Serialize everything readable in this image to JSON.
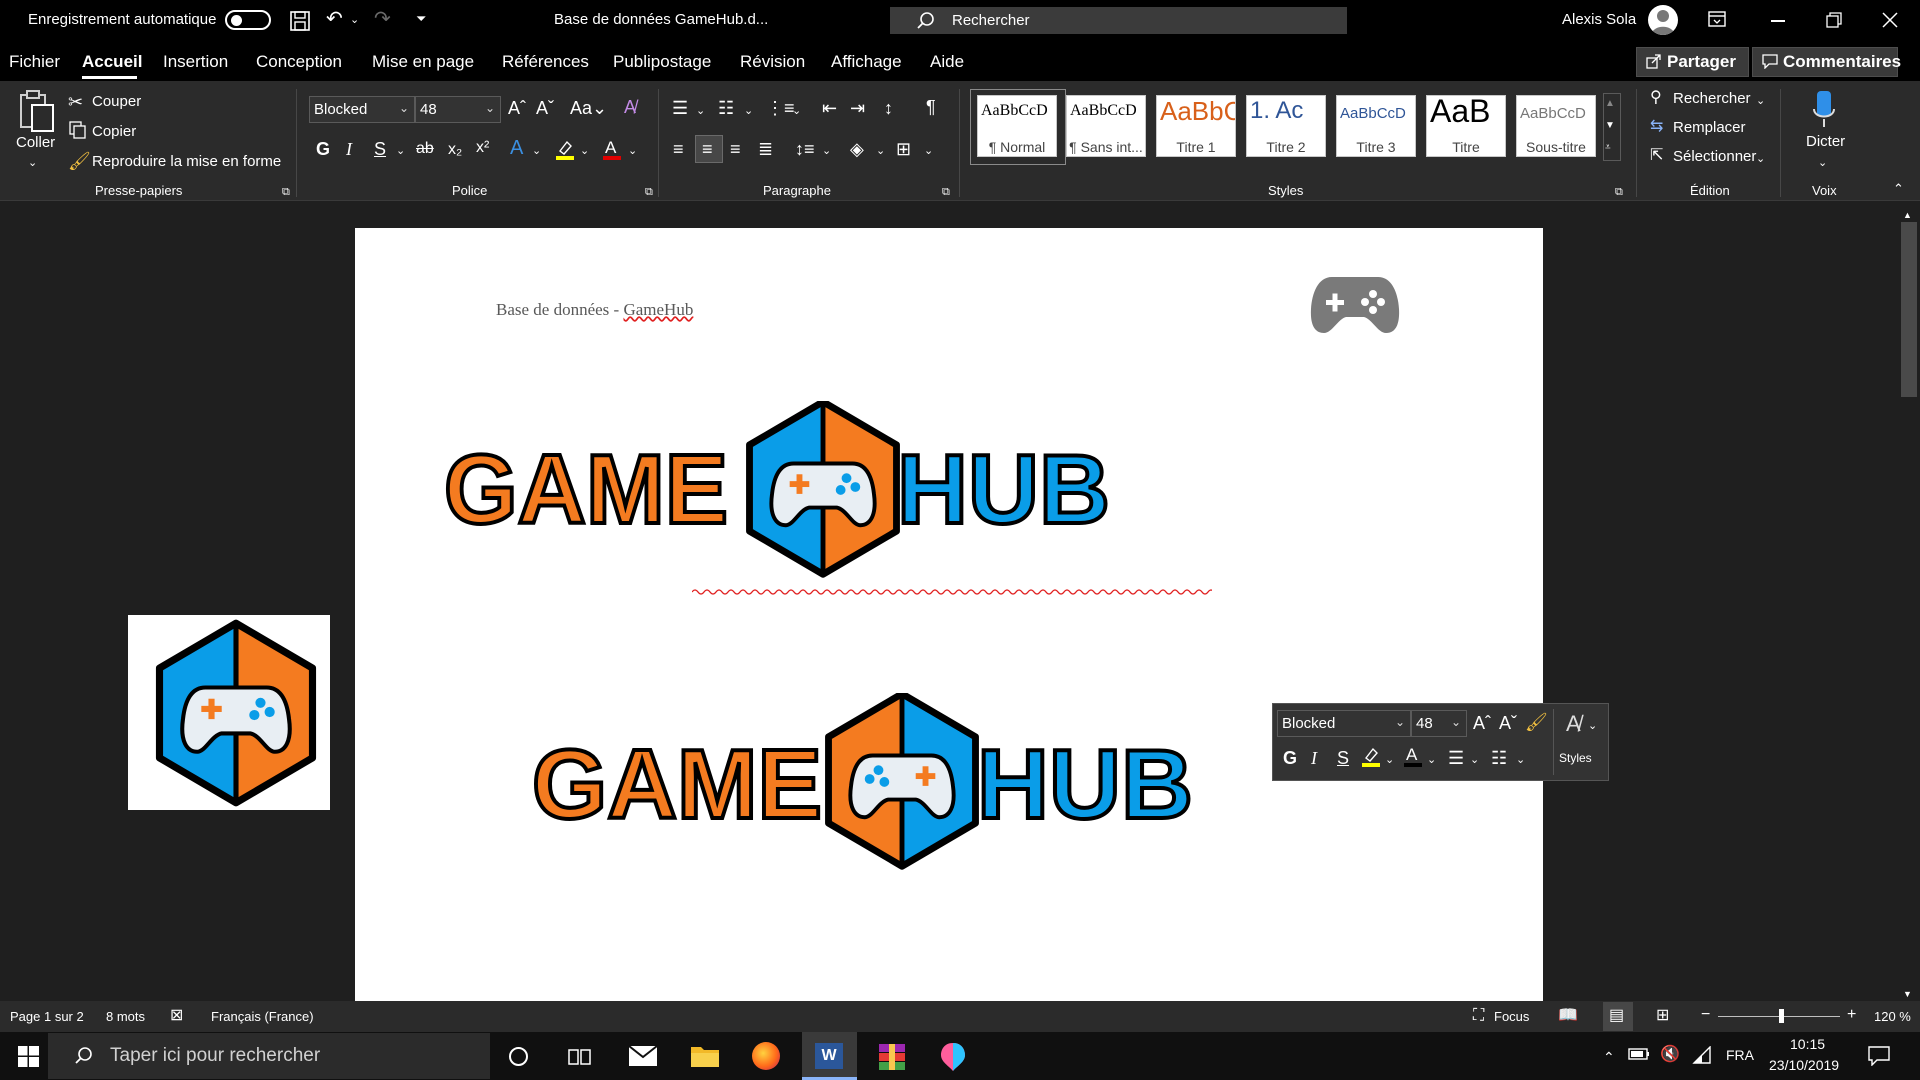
{
  "titlebar": {
    "autosave_label": "Enregistrement automatique",
    "doc_title": "Base de données GameHub.d...",
    "search_placeholder": "Rechercher",
    "user_name": "Alexis Sola"
  },
  "menu": {
    "tabs": [
      "Fichier",
      "Accueil",
      "Insertion",
      "Conception",
      "Mise en page",
      "Références",
      "Publipostage",
      "Révision",
      "Affichage",
      "Aide"
    ],
    "share_label": "Partager",
    "comments_label": "Commentaires"
  },
  "ribbon": {
    "clipboard": {
      "paste": "Coller",
      "cut": "Couper",
      "copy": "Copier",
      "format_painter": "Reproduire la mise en forme",
      "group": "Presse-papiers"
    },
    "font": {
      "family": "Blocked",
      "size": "48",
      "group": "Police"
    },
    "paragraph": {
      "group": "Paragraphe"
    },
    "styles": {
      "group": "Styles",
      "cards": [
        {
          "preview": "AaBbCcD",
          "label": "¶ Normal"
        },
        {
          "preview": "AaBbCcD",
          "label": "¶ Sans int..."
        },
        {
          "preview": "AaBbC",
          "label": "Titre 1"
        },
        {
          "preview": "1.  Ac",
          "label": "Titre 2"
        },
        {
          "preview": "AaBbCcD",
          "label": "Titre 3"
        },
        {
          "preview": "AaB",
          "label": "Titre"
        },
        {
          "preview": "AaBbCcD",
          "label": "Sous-titre"
        }
      ]
    },
    "editing": {
      "find": "Rechercher",
      "replace": "Remplacer",
      "select": "Sélectionner",
      "group": "Édition"
    },
    "voice": {
      "dictate": "Dicter",
      "group": "Voix"
    }
  },
  "document": {
    "header_text": "Base de données - ",
    "header_word": "GameHub",
    "logo_left": "GAME",
    "logo_right": "HUB"
  },
  "minitoolbar": {
    "font": "Blocked",
    "size": "48",
    "styles": "Styles"
  },
  "statusbar": {
    "page": "Page 1 sur 2",
    "words": "8 mots",
    "language": "Français (France)",
    "focus": "Focus",
    "zoom": "120 %"
  },
  "taskbar": {
    "search_placeholder": "Taper ici pour rechercher",
    "lang": "FRA",
    "time": "10:15",
    "date": "23/10/2019"
  },
  "colors": {
    "orange": "#f47b20",
    "blue": "#0a9de8",
    "black": "#000000"
  }
}
